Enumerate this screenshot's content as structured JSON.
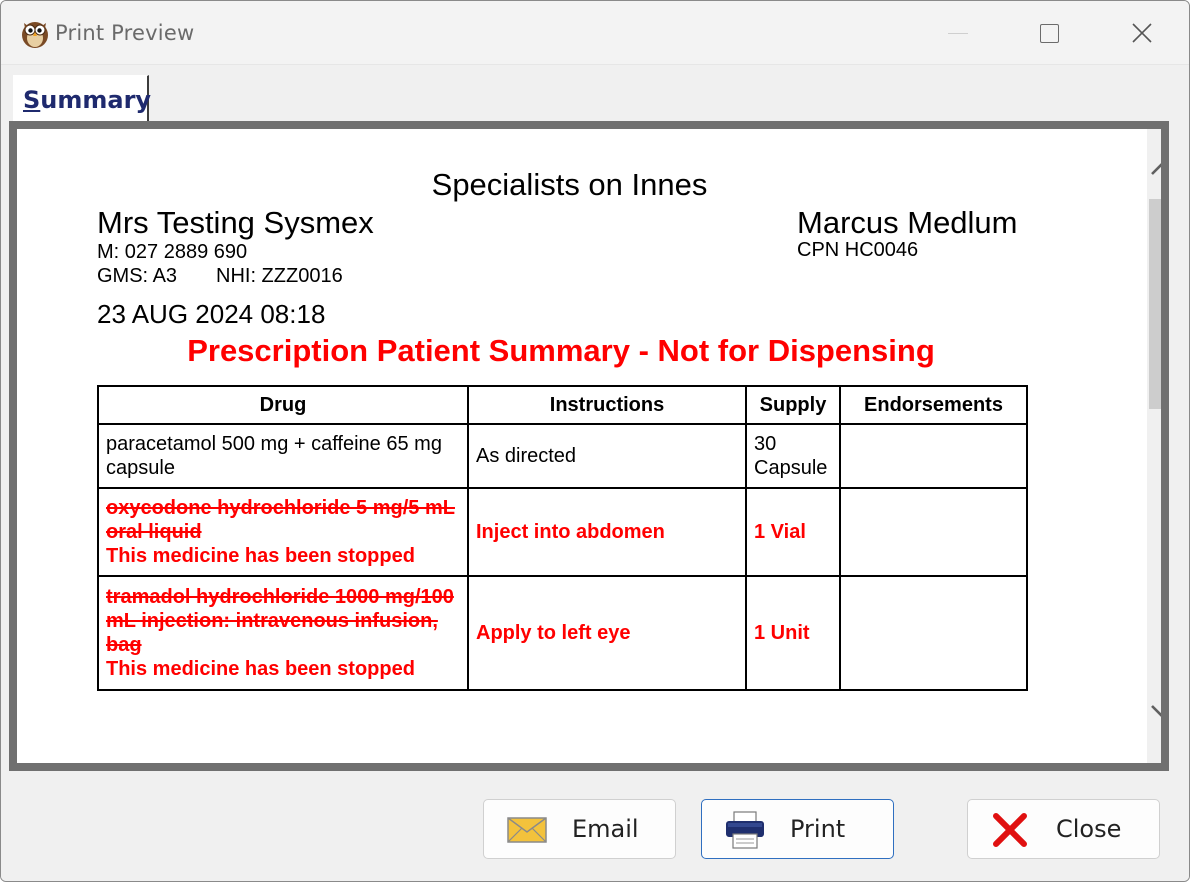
{
  "window": {
    "title": "Print Preview"
  },
  "tabs": [
    {
      "label_ul": "S",
      "label_rest": "ummary"
    }
  ],
  "document": {
    "practice": "Specialists on Innes",
    "patient_name": "Mrs Testing Sysmex",
    "patient_mobile": "M: 027 2889 690",
    "gms": "GMS: A3",
    "nhi": "NHI: ZZZ0016",
    "doctor_name": "Marcus Medlum",
    "cpn": "CPN HC0046",
    "datetime": "23 AUG 2024 08:18",
    "banner": "Prescription Patient Summary - Not for Dispensing",
    "table": {
      "headers": [
        "Drug",
        "Instructions",
        "Supply",
        "Endorsements"
      ],
      "rows": [
        {
          "drug": "paracetamol 500 mg + caffeine 65 mg capsule",
          "note": "",
          "instructions": "As directed",
          "supply": "30 Capsule",
          "endorsements": "",
          "stopped": false
        },
        {
          "drug": "oxycodone hydrochloride 5 mg/5 mL oral liquid",
          "note": "This medicine has been stopped",
          "instructions": "Inject into abdomen",
          "supply": "1 Vial",
          "endorsements": "",
          "stopped": true
        },
        {
          "drug": "tramadol hydrochloride 1000 mg/100 mL injection: intravenous infusion, bag",
          "note": "This medicine has been stopped",
          "instructions": "Apply to left eye",
          "supply": "1 Unit",
          "endorsements": "",
          "stopped": true
        }
      ]
    }
  },
  "buttons": {
    "email": "Email",
    "print": "Print",
    "close": "Close"
  },
  "colors": {
    "stopped_text": "#ff0000",
    "tab_text": "#1f2a6e",
    "default_button_border": "#2f6fc0"
  }
}
